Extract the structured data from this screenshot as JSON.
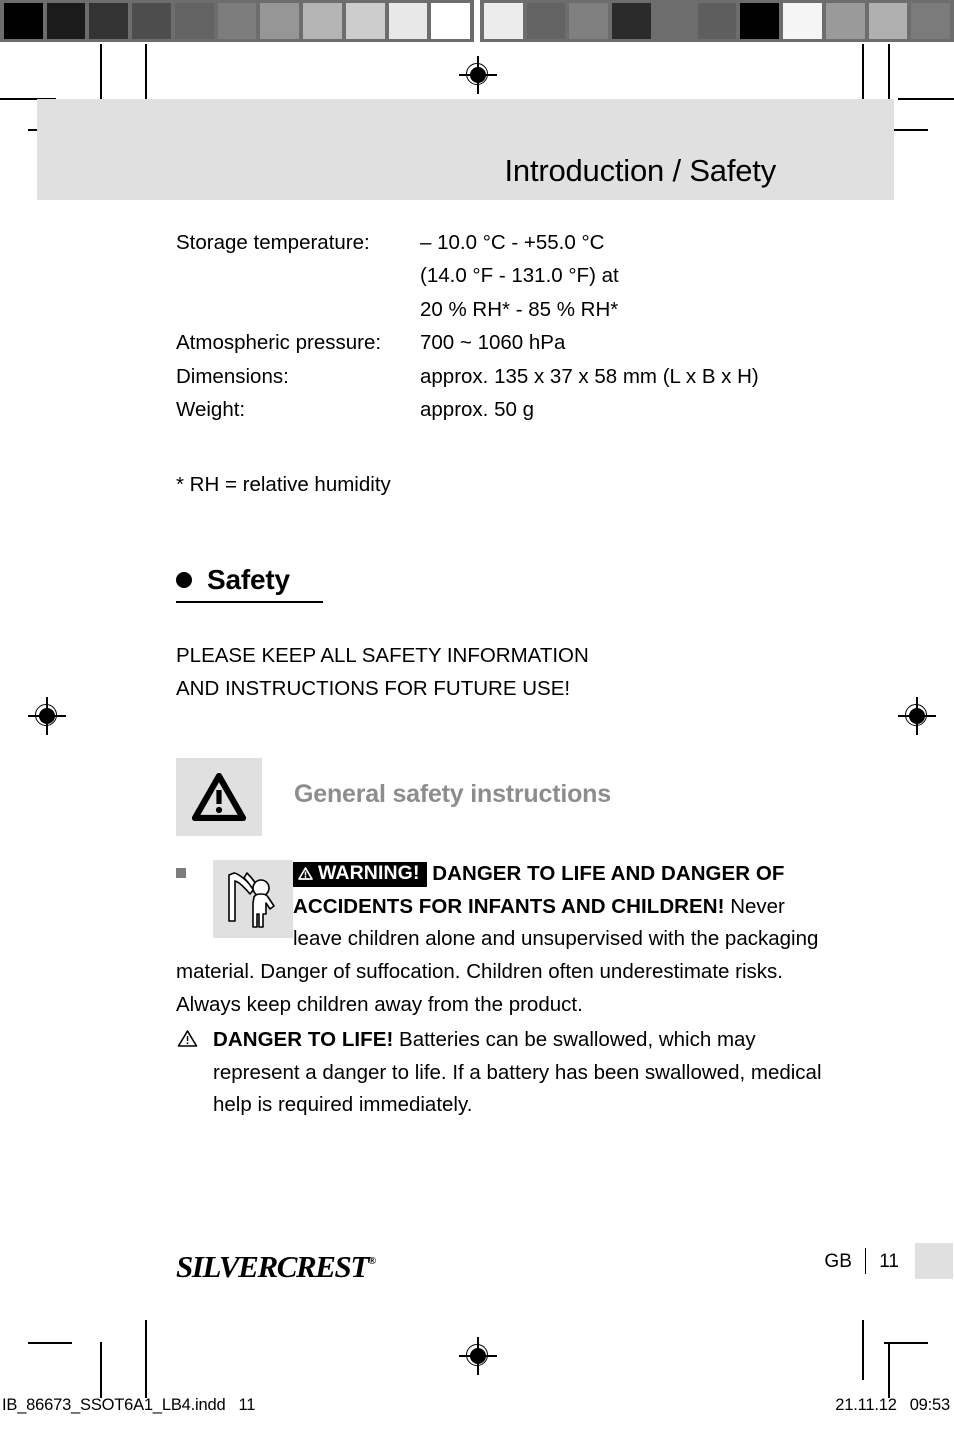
{
  "header": {
    "title": "Introduction / Safety"
  },
  "calibration": {
    "left_strip": [
      "#000000",
      "#1b1b1b",
      "#333333",
      "#4d4d4d",
      "#636363",
      "#7d7d7d",
      "#969696",
      "#b4b4b4",
      "#cdcdcd",
      "#e8e8e8",
      "#ffffff"
    ],
    "right_strip": [
      "#ececec",
      "#636363",
      "#808080",
      "#2b2b2b",
      "#6e6e6e",
      "#5e5e5e",
      "#000000",
      "#f5f5f5",
      "#9a9a9a",
      "#b0b0b0",
      "#7b7b7b"
    ]
  },
  "specs": {
    "rows": [
      {
        "label": "Storage temperature:",
        "value": "– 10.0 °C - +55.0 °C"
      },
      {
        "label": "",
        "value": "(14.0 °F - 131.0 °F) at"
      },
      {
        "label": "",
        "value": "20 % RH* - 85 % RH*"
      },
      {
        "label": "Atmospheric pressure:",
        "value": "700 ~ 1060 hPa"
      },
      {
        "label": "Dimensions:",
        "value": "approx. 135 x 37 x 58 mm (L x B x H)"
      },
      {
        "label": "Weight:",
        "value": "approx. 50 g"
      }
    ],
    "footnote": "* RH = relative humidity"
  },
  "safety": {
    "heading": "Safety",
    "keep_info_line1": "PLEASE KEEP ALL SAFETY INFORMATION",
    "keep_info_line2": "AND INSTRUCTIONS FOR FUTURE USE!",
    "general_instructions_title": "General safety instructions",
    "warning_badge": "WARNING!",
    "warning_bold": "DANGER TO LIFE AND DANGER OF ACCIDENTS FOR INFANTS AND CHILDREN!",
    "warning_body": "Never leave children alone and unsupervised with the packaging material. Danger of suffocation. Children often underestimate risks. Always keep children away from the product.",
    "danger_bold": "DANGER TO LIFE!",
    "danger_body": "Batteries can be swallowed, which may represent a danger to life. If a battery has been swallowed, medical help is required immediately."
  },
  "footer": {
    "brand": "SILVERCREST",
    "brand_registered": "®",
    "language": "GB",
    "page_number": "11"
  },
  "slug": {
    "file": "IB_86673_SSOT6A1_LB4.indd",
    "file_page": "11",
    "date": "21.11.12",
    "time": "09:53"
  },
  "colors": {
    "header_band": "#e0e0e0",
    "icon_box": "#e0e0e0",
    "gsi_title": "#8d8d8d",
    "square_bullet": "#7c7c7c"
  }
}
